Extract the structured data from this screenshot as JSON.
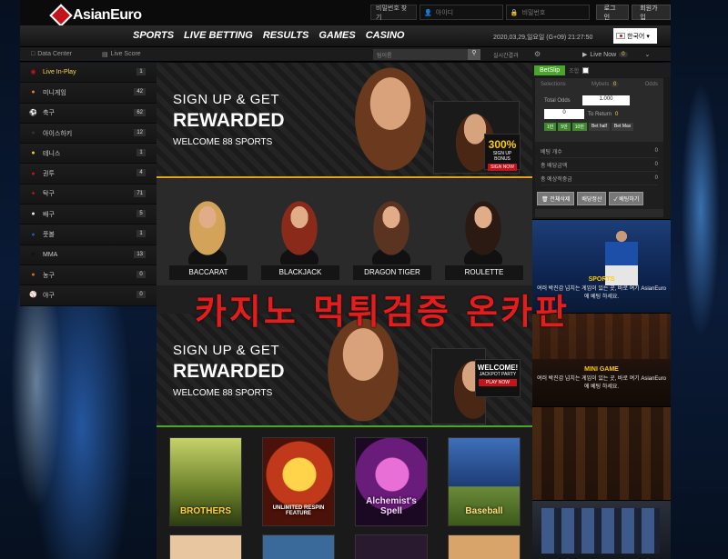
{
  "brand": {
    "name": "AsianEuro"
  },
  "topbar": {
    "find_password": "비밀번호 찾기",
    "id_placeholder": "아이디",
    "pw_placeholder": "비밀번호",
    "login_label": "로그인",
    "signup_label": "회원가입"
  },
  "nav": {
    "items": [
      "SPORTS",
      "LIVE BETTING",
      "RESULTS",
      "GAMES",
      "CASINO"
    ],
    "datetime": "2020,03,29,일요일 (G+09) 21:27:50",
    "language": "한국어"
  },
  "subbar": {
    "data_center": "Data Center",
    "live_score": "Live Score",
    "search_placeholder": "팀이름",
    "live_results": "실시간결과",
    "live_now": "Live Now",
    "live_now_count": "0"
  },
  "sidebar": {
    "items": [
      {
        "label": "Live In-Play",
        "count": "1",
        "icon": "live-icon",
        "color": "#c3141c"
      },
      {
        "label": "미니게임",
        "count": "42",
        "icon": "minigame-icon",
        "color": "#e77b3a"
      },
      {
        "label": "축구",
        "count": "62",
        "icon": "soccer-icon",
        "color": "#ffffff"
      },
      {
        "label": "아이스하키",
        "count": "12",
        "icon": "hockey-icon",
        "color": "#333333"
      },
      {
        "label": "테니스",
        "count": "1",
        "icon": "tennis-icon",
        "color": "#e0d23a"
      },
      {
        "label": "권투",
        "count": "4",
        "icon": "boxing-icon",
        "color": "#c3141c"
      },
      {
        "label": "탁구",
        "count": "71",
        "icon": "table-tennis-icon",
        "color": "#c3141c"
      },
      {
        "label": "배구",
        "count": "5",
        "icon": "volleyball-icon",
        "color": "#eeeeee"
      },
      {
        "label": "풋볼",
        "count": "1",
        "icon": "football-icon",
        "color": "#2255aa"
      },
      {
        "label": "MMA",
        "count": "13",
        "icon": "mma-icon",
        "color": "#111111"
      },
      {
        "label": "농구",
        "count": "0",
        "icon": "basketball-icon",
        "color": "#e06a1c"
      },
      {
        "label": "야구",
        "count": "0",
        "icon": "baseball-icon",
        "color": "#eeeeee"
      }
    ]
  },
  "banners": [
    {
      "line1": "SIGN UP & GET",
      "line2": "REWARDED",
      "line3": "WELCOME 88 SPORTS",
      "promo_pct": "300%",
      "promo_sub": "SIGN UP BONUS",
      "promo_btn": "SIGN NOW"
    },
    {
      "line1": "SIGN UP & GET",
      "line2": "REWARDED",
      "line3": "WELCOME 88 SPORTS",
      "promo_pct": "WELCOME!",
      "promo_sub": "JACKPOT PARTY",
      "promo_btn": "PLAY NOW"
    }
  ],
  "casino_games": [
    "BACCARAT",
    "BLACKJACK",
    "DRAGON TIGER",
    "ROULETTE"
  ],
  "slot_games": [
    "BROTHERS",
    "UNLIMITED RESPIN FEATURE",
    "Alchemist's Spell",
    "Baseball"
  ],
  "betslip": {
    "tab": "BetSlip",
    "combo": "조합",
    "tabs": [
      "Selections",
      "Mybets",
      "Odds"
    ],
    "mybets_count": "0",
    "total_odds_label": "Total Odds",
    "total_odds_value": "1.000",
    "stake_value": "0",
    "to_return_label": "To Return",
    "to_return_value": "0",
    "chips": [
      "1만",
      "5만",
      "10만",
      "Bet half",
      "Bet Max"
    ],
    "stats": [
      {
        "label": "베팅 개수",
        "value": "0"
      },
      {
        "label": "총 배당금액",
        "value": "0"
      },
      {
        "label": "총 예상적중금",
        "value": "0"
      }
    ],
    "actions": [
      "전체삭제",
      "배당정산",
      "베팅하기"
    ]
  },
  "side_promos": [
    {
      "title": "SPORTS",
      "desc": "여러 박진감 넘치는 게임이 있는 곳, 바로 여기 AsianEuro에 베팅 하세요."
    },
    {
      "title": "MINI GAME",
      "desc": "여러 박진감 넘치는 게임이 있는 곳, 바로 여기 AsianEuro에 베팅 하세요."
    },
    {
      "title": "",
      "desc": ""
    }
  ],
  "overlay_text": "카지노 먹튀검증 온카판",
  "colors": {
    "accent_green": "#4ba42c",
    "accent_gold": "#e8a317",
    "overlay_red": "#e51c1c",
    "brand_red": "#c3141c"
  }
}
